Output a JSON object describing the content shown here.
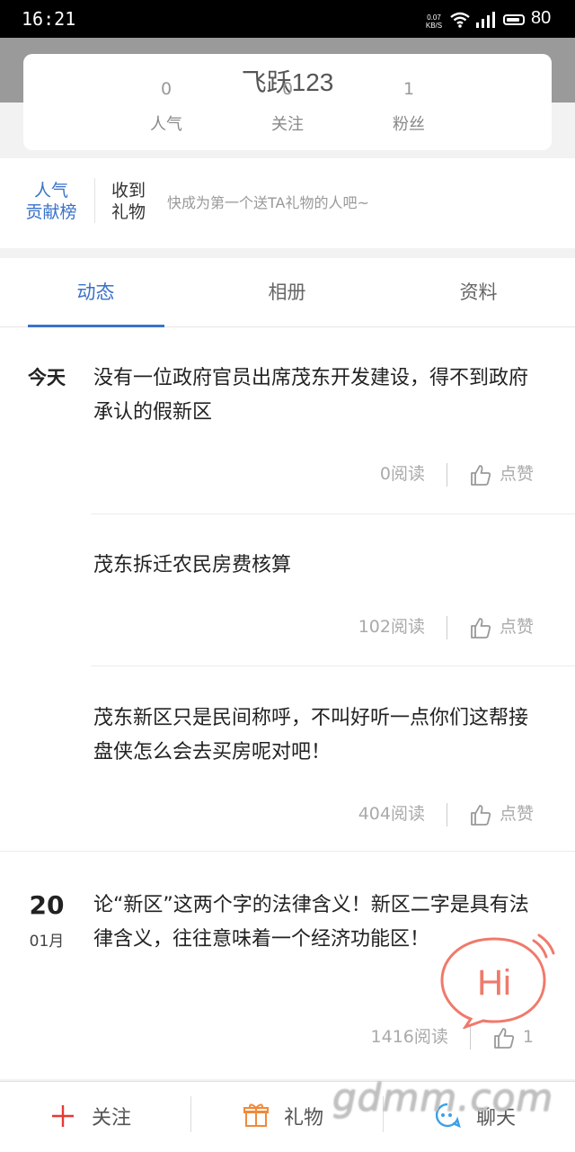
{
  "status_bar": {
    "time": "16:21",
    "net_speed_value": "0.07",
    "net_speed_unit": "KB/S",
    "battery": "80"
  },
  "profile": {
    "name": "飞跃123",
    "stats": [
      {
        "value": "0",
        "label": "人气"
      },
      {
        "value": "0",
        "label": "关注"
      },
      {
        "value": "1",
        "label": "粉丝"
      }
    ]
  },
  "contribution": {
    "rank_line1": "人气",
    "rank_line2": "贡献榜",
    "received_line1": "收到",
    "received_line2": "礼物",
    "tip": "快成为第一个送TA礼物的人吧~"
  },
  "tabs": [
    {
      "label": "动态",
      "active": true
    },
    {
      "label": "相册",
      "active": false
    },
    {
      "label": "资料",
      "active": false
    }
  ],
  "feed": {
    "posts": [
      {
        "date": "今天",
        "text": "没有一位政府官员出席茂东开发建设，得不到政府承认的假新区",
        "reads": "0阅读",
        "likes": "点赞"
      },
      {
        "text": "茂东拆迁农民房费核算",
        "reads": "102阅读",
        "likes": "点赞"
      },
      {
        "text": "茂东新区只是民间称呼，不叫好听一点你们这帮接盘侠怎么会去买房呢对吧！",
        "reads": "404阅读",
        "likes": "点赞"
      },
      {
        "day": "20",
        "month": "01月",
        "text": "论“新区”这两个字的法律含义！新区二字是具有法律含义，往往意味着一个经济功能区！",
        "reads": "1416阅读",
        "likes": "1"
      }
    ]
  },
  "hi_bubble": {
    "label": "Hi",
    "color": "#ef7a6b"
  },
  "bottom_bar": {
    "follow": "关注",
    "gift": "礼物",
    "chat": "聊天"
  },
  "watermark": "gdmm.com",
  "colors": {
    "accent": "#3a72c9",
    "follow_icon": "#e53935",
    "gift_icon": "#f08a3c",
    "chat_icon": "#3aa0e8"
  }
}
